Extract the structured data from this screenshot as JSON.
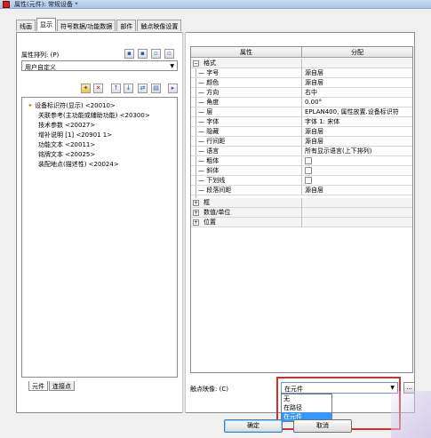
{
  "window": {
    "title": "属性(元件): 常规设备 *"
  },
  "tabs": [
    "线画",
    "显示",
    "符号数据/功能数据",
    "部件",
    "触点映像设置"
  ],
  "active_tab": 1,
  "left": {
    "sort_label": "属性排列: (P)",
    "sort_value": "用户自定义",
    "items": [
      "设备标识符(显示) <20010>",
      "关联参考(主功能或辅助功能) <20300>",
      "技术参数 <20027>",
      "增补说明 [1] <20901 1>",
      "功能文本 <20011>",
      "铭牌文本 <20025>",
      "装配地点(描述性) <20024>"
    ],
    "bottom_tabs": [
      "元件",
      "连接点"
    ]
  },
  "grid": {
    "col_property": "属性",
    "col_value": "分配",
    "group_format": "格式",
    "rows": [
      {
        "name": "字号",
        "value": "源自层",
        "type": "text"
      },
      {
        "name": "颜色",
        "value": "源自层",
        "type": "text"
      },
      {
        "name": "方向",
        "value": "右中",
        "type": "text"
      },
      {
        "name": "角度",
        "value": "0.00°",
        "type": "text"
      },
      {
        "name": "层",
        "value": "EPLAN400, 属性放置.设备标识符",
        "type": "text"
      },
      {
        "name": "字体",
        "value": "字体 1: 宋体",
        "type": "text"
      },
      {
        "name": "隐藏",
        "value": "源自层",
        "type": "text"
      },
      {
        "name": "行间距",
        "value": "源自层",
        "type": "text"
      },
      {
        "name": "语言",
        "value": "所有显示语言(上下排列)",
        "type": "text"
      },
      {
        "name": "粗体",
        "value": "",
        "type": "check"
      },
      {
        "name": "斜体",
        "value": "",
        "type": "check"
      },
      {
        "name": "下划线",
        "value": "",
        "type": "check"
      },
      {
        "name": "段落间距",
        "value": "源自层",
        "type": "text"
      }
    ],
    "groups_collapsed": [
      "框",
      "数值/单位",
      "位置"
    ]
  },
  "contact": {
    "label": "触点映像: (C)",
    "value": "在元件",
    "options": [
      "无",
      "在路径",
      "在元件"
    ],
    "selected_index": 2,
    "more_label": "..."
  },
  "buttons": {
    "ok": "确定",
    "cancel": "取消"
  }
}
